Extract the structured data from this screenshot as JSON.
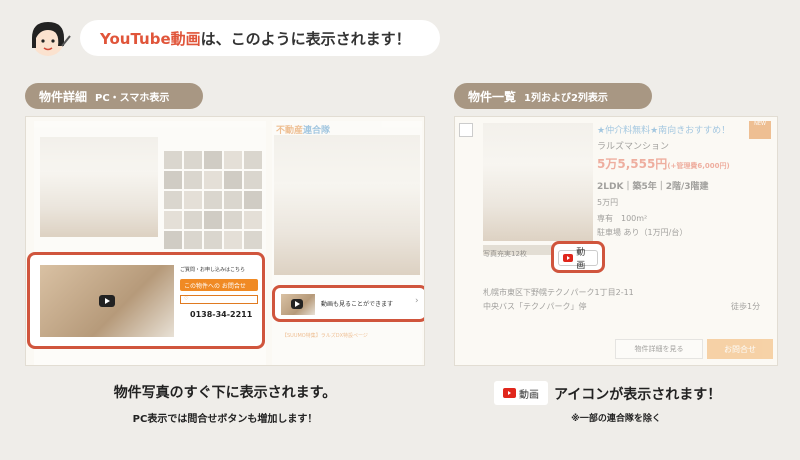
{
  "header": {
    "message_accent": "YouTube動画",
    "message_rest": "は、このように表示されます！"
  },
  "left": {
    "pill_label": "物件詳細",
    "pill_sub": "PC・スマホ表示",
    "mock": {
      "site_title": "不動産",
      "site_title_accent": "連合隊",
      "contact_button": "この物件への お問合せ",
      "phone": "0138-34-2211",
      "video_link": "動画も見ることができます",
      "footer_link": "【SUUMO特集】ラルズDX特設ページ"
    },
    "caption_main": "物件写真のすぐ下に表示されます。",
    "caption_sub": "PC表示では問合せボタンも増加します！"
  },
  "right": {
    "pill_label": "物件一覧",
    "pill_sub": "1列および2列表示",
    "listing": {
      "tagline": "★仲介料無料★南向きおすすめ！",
      "name": "ラルズマンション",
      "rent": "5万5,555円",
      "fee": "(+管理費6,000円)",
      "layout": "2LDK｜築5年｜2階/3階建",
      "deposit": "5万円",
      "area": "専有　100m²",
      "parking": "駐車場 あり（1万円/台）",
      "photo_count": "写真充実12枚",
      "video_badge": "動画",
      "address": "札幌市東区下野幌テクノパーク1丁目2-11",
      "transit": "中央バス「テクノパーク」停",
      "walk": "徒歩1分",
      "detail_btn": "物件詳細を見る",
      "inquiry_btn": "お問合せ"
    },
    "caption_icon_label": "動画",
    "caption_main": "アイコンが表示されます！",
    "caption_sub": "※一部の連合隊を除く"
  }
}
